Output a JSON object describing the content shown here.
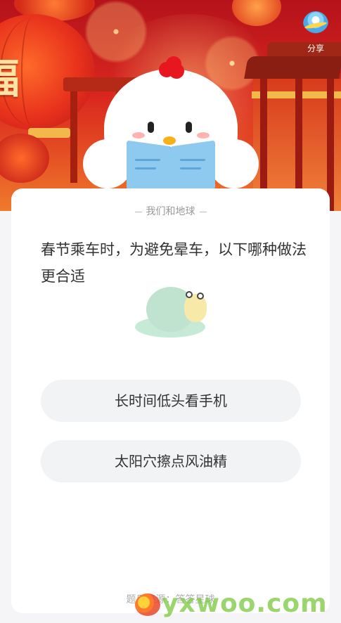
{
  "header": {
    "banner_char": "福",
    "share_label": "分享"
  },
  "card": {
    "source_label": "我们和地球",
    "question": "春节乘车时，为避免晕车，以下哪种做法更合适",
    "options": [
      {
        "label": "长时间低头看手机"
      },
      {
        "label": "太阳穴擦点风油精"
      }
    ],
    "footer": "题目来源：答答星球"
  },
  "watermark": {
    "text": "yxwoo.com"
  },
  "colors": {
    "hero_red": "#d9261f",
    "card_bg": "#ffffff",
    "option_bg": "#f2f3f5",
    "text_primary": "#333333",
    "text_muted": "#9a9a9a",
    "watermark_green": "#78c83c"
  },
  "icons": {
    "share": "planet-share-icon",
    "mascot": "chick-reading-book",
    "card_illustration": "snail-icon"
  }
}
